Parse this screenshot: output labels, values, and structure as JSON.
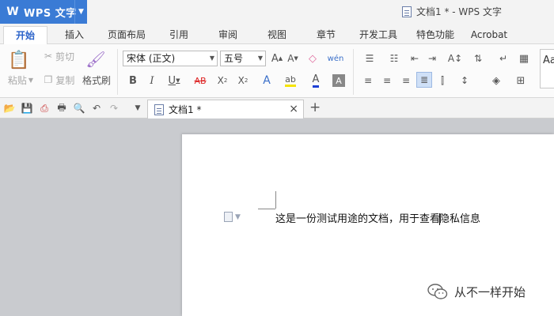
{
  "app": {
    "name": "WPS 文字",
    "window_title": "文档1 * - WPS 文字"
  },
  "menu_tabs": [
    {
      "label": "开始",
      "active": true
    },
    {
      "label": "插入"
    },
    {
      "label": "页面布局"
    },
    {
      "label": "引用"
    },
    {
      "label": "审阅"
    },
    {
      "label": "视图"
    },
    {
      "label": "章节"
    },
    {
      "label": "开发工具"
    },
    {
      "label": "特色功能"
    },
    {
      "label": "Acrobat"
    }
  ],
  "ribbon": {
    "paste": "粘贴",
    "cut": "剪切",
    "copy": "复制",
    "format_painter": "格式刷",
    "font_name": "宋体 (正文)",
    "font_size": "五号",
    "style_preview": "Aa"
  },
  "document_tab": {
    "label": "文档1 *"
  },
  "document": {
    "text_before_caret": "这是一份测试用途的文档，用于查看",
    "text_after_caret": "隐私信息"
  },
  "watermark": {
    "text": "从不一样开始"
  },
  "colors": {
    "brand_blue": "#3a7bd5",
    "active_tab_text": "#2a62c9",
    "highlight_yellow": "#f5e400",
    "font_color_blue": "#1c3fd4"
  }
}
